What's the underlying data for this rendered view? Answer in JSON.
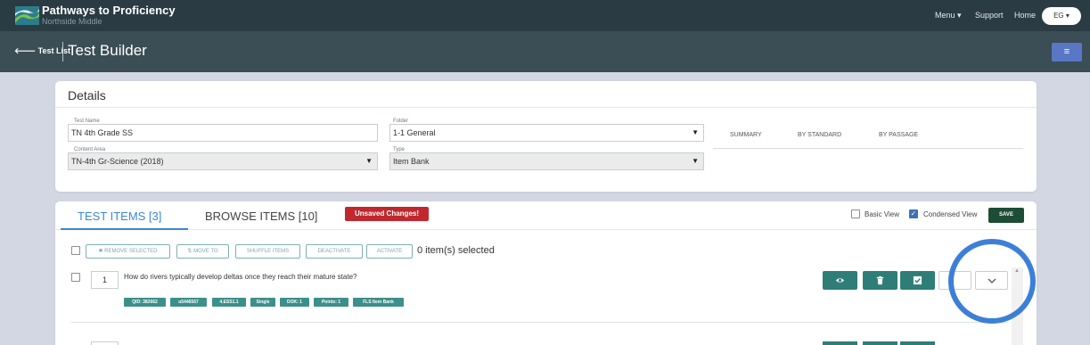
{
  "app": {
    "title": "Pathways to Proficiency",
    "subtitle": "Northside Middle"
  },
  "nav": {
    "menu_label": "Menu",
    "support_label": "Support",
    "home_label": "Home",
    "user_initials": "EG"
  },
  "subheader": {
    "back_label": "Test List",
    "page_title": "Test Builder",
    "menu_icon": "hamburger-icon"
  },
  "details": {
    "title": "Details",
    "test_name": {
      "label": "Test Name",
      "value": "TN 4th Grade SS"
    },
    "folder": {
      "label": "Folder",
      "value": "1-1 General"
    },
    "content_area": {
      "label": "Content Area",
      "value": "TN-4th Gr-Science (2018)"
    },
    "type": {
      "label": "Type",
      "value": "Item Bank"
    },
    "summary_tabs": [
      "SUMMARY",
      "BY STANDARD",
      "BY PASSAGE"
    ]
  },
  "items_panel": {
    "tab_test_items": "TEST ITEMS [3]",
    "tab_browse_items": "BROWSE ITEMS [10]",
    "unsaved_badge": "Unsaved Changes!",
    "basic_view_label": "Basic View",
    "condensed_view_label": "Condensed View",
    "basic_view_checked": false,
    "condensed_view_checked": true,
    "save_label": "SAVE",
    "actions": {
      "remove_selected": "✖ REMOVE SELECTED",
      "move_to": "⇅ MOVE TO",
      "shuffle_items": "SHUFFLE ITEMS",
      "deactivate": "DEACTIVATE",
      "activate": "ACTIVATE"
    },
    "selected_count_text": "0 item(s) selected",
    "items": [
      {
        "number": "1",
        "question": "How do rivers typically develop deltas once they reach their mature state?",
        "tags": [
          "QID: 382662",
          "u5446567",
          "4.ESS1.1",
          "Single",
          "DOK: 1",
          "Points: 1",
          "FLS Item Bank"
        ],
        "buttons": [
          "eye-icon",
          "trash-icon",
          "checkbox-icon",
          "blank",
          "chevron-down-icon"
        ]
      }
    ]
  },
  "colors": {
    "topbar": "#2a3b44",
    "subbar": "#3b4d55",
    "accent_blue": "#3a86d6",
    "teal": "#2f7d77",
    "tag_teal": "#3c8f8a",
    "unsaved_red": "#c0282d",
    "save_green": "#1d4d33",
    "highlight_ring": "#3d7fd8"
  }
}
